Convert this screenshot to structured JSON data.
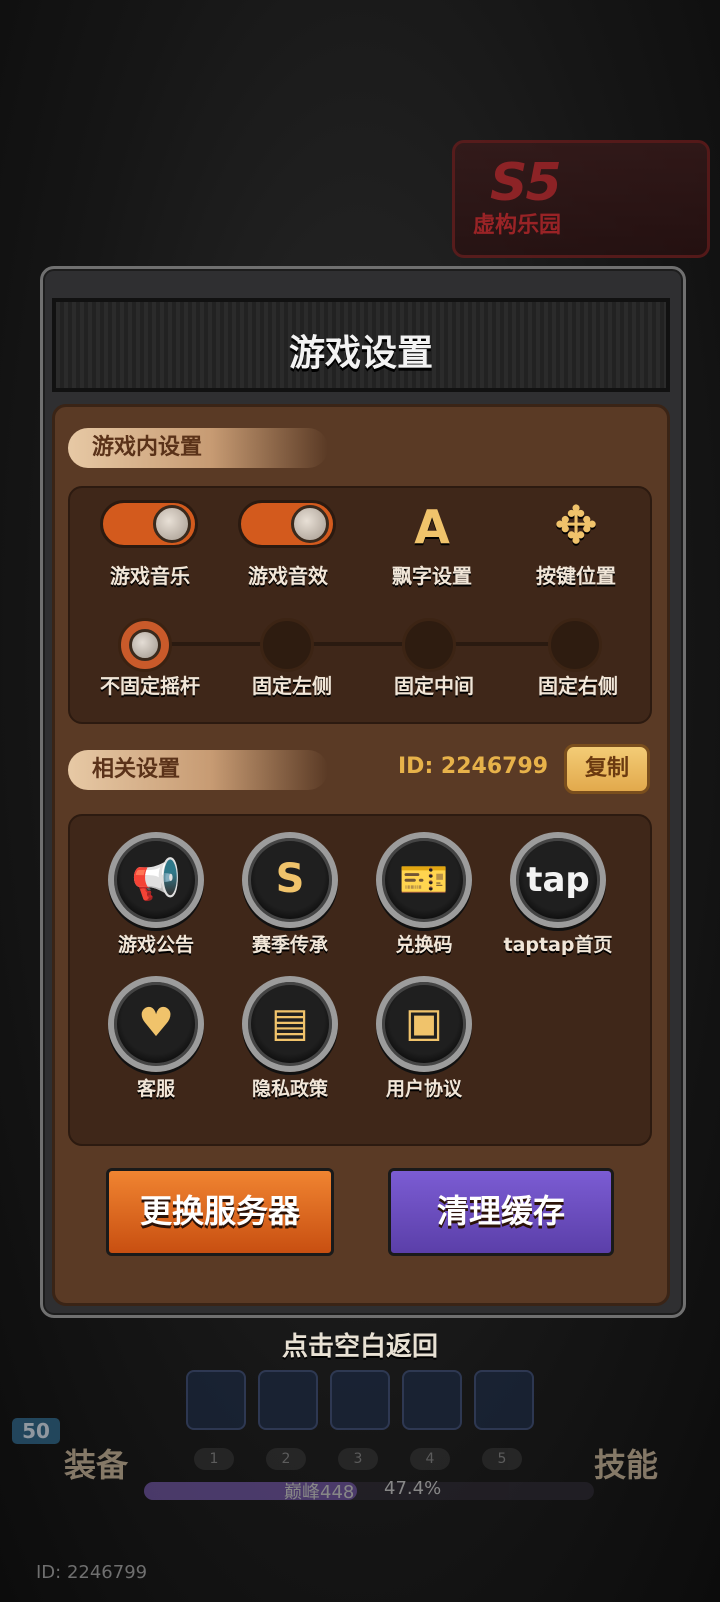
{
  "season": {
    "code": "S5",
    "name": "虚构乐园"
  },
  "dialog": {
    "title": "游戏设置"
  },
  "in_game": {
    "label": "游戏内设置",
    "music": "游戏音乐",
    "sfx": "游戏音效",
    "float_text": "飘字设置",
    "key_position": "按键位置",
    "joystick_options": [
      "不固定摇杆",
      "固定左侧",
      "固定中间",
      "固定右侧"
    ]
  },
  "related": {
    "label": "相关设置",
    "id_text": "ID: 2246799",
    "copy_label": "复制",
    "items": [
      "游戏公告",
      "赛季传承",
      "兑换码",
      "taptap首页",
      "客服",
      "隐私政策",
      "用户协议"
    ]
  },
  "buttons": {
    "change_server": "更换服务器",
    "clear_cache": "清理缓存"
  },
  "hint": "点击空白返回",
  "bottom": {
    "equip": "装备",
    "skill": "技能",
    "level": "50",
    "slots": [
      "1",
      "2",
      "3",
      "4",
      "5"
    ],
    "peak_label": "巅峰448",
    "percent_text": "47.4%",
    "progress": 0.474,
    "id_text": "ID: 2246799"
  }
}
